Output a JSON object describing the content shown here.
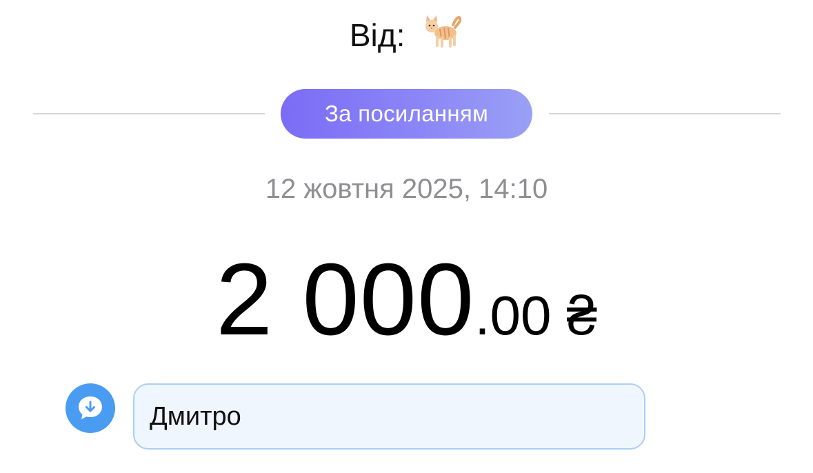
{
  "header": {
    "from_label": "Від:",
    "from_avatar_icon": "cat-emoji-icon"
  },
  "transfer": {
    "type_label": "За посиланням",
    "date": "12 жовтня 2025, 14:10",
    "amount_integer": "2 000",
    "amount_fraction": ".00",
    "currency_symbol": "₴"
  },
  "comment": {
    "icon": "comment-download-icon",
    "text": "Дмитро"
  },
  "colors": {
    "pill_gradient_start": "#7b6cf6",
    "pill_gradient_end": "#9aa0f5",
    "comment_icon_bg": "#4a9cf2",
    "comment_box_bg": "#f0f6fe",
    "comment_box_border": "#a9cff5",
    "date_text": "#8e8e93"
  }
}
